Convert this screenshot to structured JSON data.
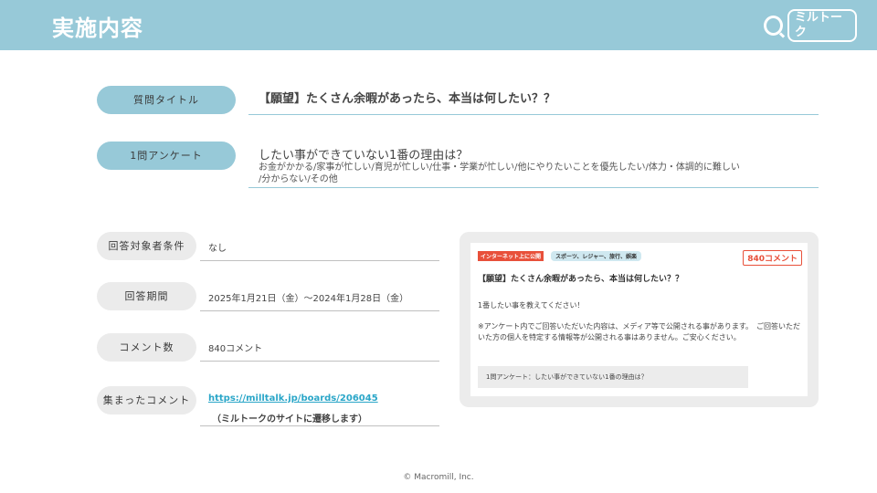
{
  "header": {
    "title": "実施内容",
    "logo_text": "ミルトーク"
  },
  "survey": {
    "title_label": "質問タイトル",
    "title_value": "【願望】たくさん余暇があったら、本当は何したい？？",
    "question_label": "1問アンケート",
    "question_value": "したい事ができていない1番の理由は？",
    "options_line1": "お金がかかる/家事が忙しい/育児が忙しい/仕事・学業が忙しい/他にやりたいことを優先したい/体力・体調的に難しい",
    "options_line2": "/分からない/その他"
  },
  "details": {
    "condition_label": "回答対象者条件",
    "condition_value": "なし",
    "period_label": "回答期間",
    "period_value": "2025年1月21日（金）～2024年1月28日（金）",
    "comment_count_label": "コメント数",
    "comment_count_value": "840コメント",
    "collected_label": "集まったコメント",
    "collected_link": "https://milltalk.jp/boards/206045",
    "collected_note": "（ミルトークのサイトに遷移します）"
  },
  "preview": {
    "tag_public": "インターネット上に公開",
    "tag_category": "スポーツ、レジャー、旅行、娯楽",
    "comment_badge": "840コメント",
    "title": "【願望】たくさん余暇があったら、本当は何したい？？",
    "body1": "1番したい事を教えてください！",
    "body2": "※アンケート内でご回答いただいた内容は、メディア等で公開される事があります。　ご回答いただいた方の個人を特定する情報等が公開される事はありません。ご安心ください。",
    "question_box": "1問アンケート：したい事ができていない1番の理由は？"
  },
  "footer": {
    "copyright": "© Macromill, Inc."
  },
  "colors": {
    "header_bg": "#97c9d8",
    "accent_red": "#e8503a",
    "link": "#2aa6c8"
  }
}
